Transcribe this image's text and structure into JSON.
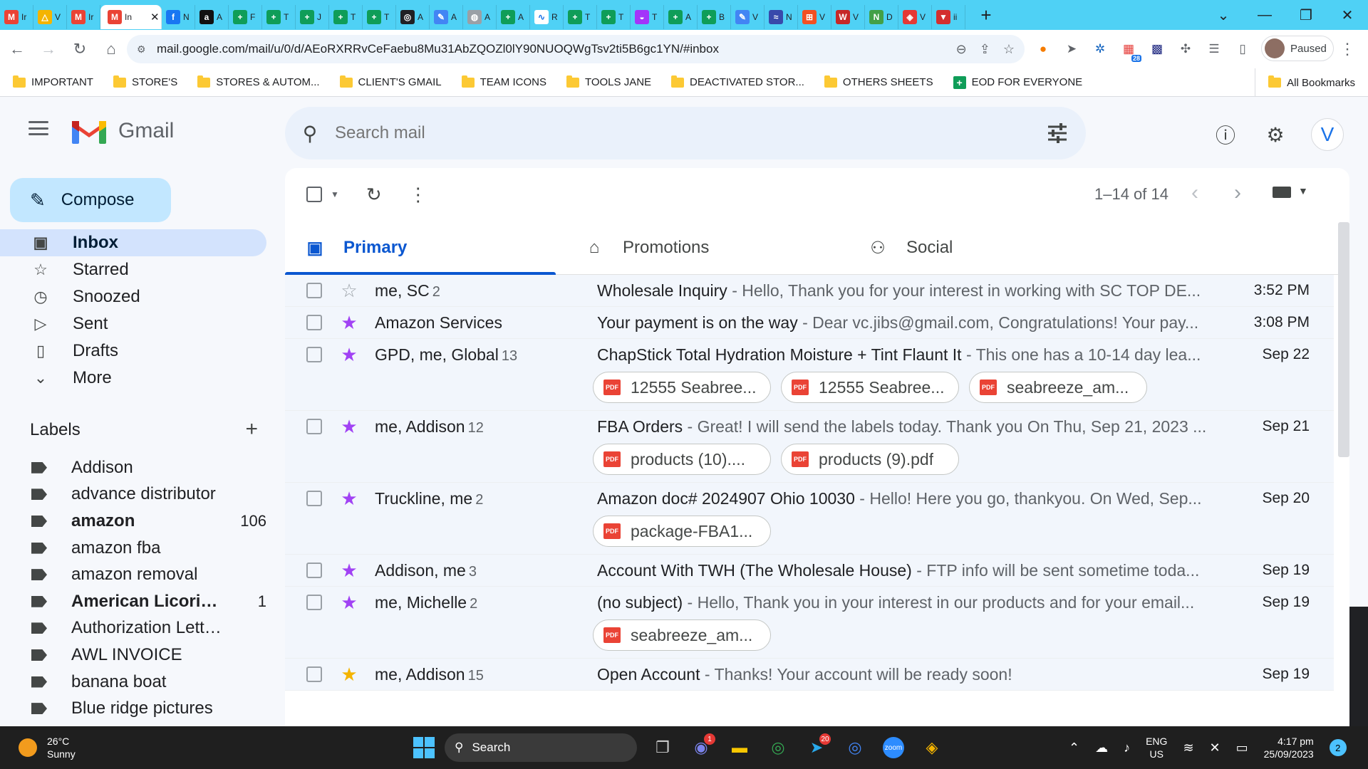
{
  "browser": {
    "tabs": [
      {
        "icon": "gmail-icon",
        "label": "Ir",
        "color": "#ea4335",
        "glyph": "M"
      },
      {
        "icon": "drive-icon",
        "label": "V",
        "color": "#f4b400",
        "glyph": "△"
      },
      {
        "icon": "gmail-icon",
        "label": "Ir",
        "color": "#ea4335",
        "glyph": "M"
      },
      {
        "icon": "gmail-icon",
        "label": "In",
        "color": "#ea4335",
        "glyph": "M",
        "active": true
      },
      {
        "icon": "facebook-icon",
        "label": "N",
        "color": "#1877f2",
        "glyph": "f"
      },
      {
        "icon": "amazon-icon",
        "label": "A",
        "color": "#111111",
        "glyph": "a"
      },
      {
        "icon": "sheets-icon",
        "label": "F",
        "color": "#0f9d58",
        "glyph": "+"
      },
      {
        "icon": "sheets-icon",
        "label": "T",
        "color": "#0f9d58",
        "glyph": "+"
      },
      {
        "icon": "sheets-icon",
        "label": "J",
        "color": "#0f9d58",
        "glyph": "+"
      },
      {
        "icon": "sheets-icon",
        "label": "T",
        "color": "#0f9d58",
        "glyph": "+"
      },
      {
        "icon": "sheets-icon",
        "label": "T",
        "color": "#0f9d58",
        "glyph": "+"
      },
      {
        "icon": "chatgpt-icon",
        "label": "A",
        "color": "#202124",
        "glyph": "◎"
      },
      {
        "icon": "pencil-icon",
        "label": "A",
        "color": "#4285f4",
        "glyph": "✎"
      },
      {
        "icon": "globe-icon",
        "label": "A",
        "color": "#9aa0a6",
        "glyph": "◍"
      },
      {
        "icon": "sheets-icon",
        "label": "A",
        "color": "#0f9d58",
        "glyph": "+"
      },
      {
        "icon": "chart-icon",
        "label": "R",
        "color": "#ffffff",
        "glyph": "∿"
      },
      {
        "icon": "sheets-icon",
        "label": "T",
        "color": "#0f9d58",
        "glyph": "+"
      },
      {
        "icon": "sheets-icon",
        "label": "T",
        "color": "#0f9d58",
        "glyph": "+"
      },
      {
        "icon": "messenger-icon",
        "label": "T",
        "color": "#a334fa",
        "glyph": "◒"
      },
      {
        "icon": "sheets-icon",
        "label": "A",
        "color": "#0f9d58",
        "glyph": "+"
      },
      {
        "icon": "sheets-icon",
        "label": "B",
        "color": "#0f9d58",
        "glyph": "+"
      },
      {
        "icon": "pencil-icon",
        "label": "V",
        "color": "#4285f4",
        "glyph": "✎"
      },
      {
        "icon": "wave-icon",
        "label": "N",
        "color": "#3949ab",
        "glyph": "≈"
      },
      {
        "icon": "microsoft-icon",
        "label": "V",
        "color": "#f25022",
        "glyph": "⊞"
      },
      {
        "icon": "w-icon",
        "label": "V",
        "color": "#c62828",
        "glyph": "W"
      },
      {
        "icon": "n-icon",
        "label": "D",
        "color": "#43a047",
        "glyph": "N"
      },
      {
        "icon": "shop-icon",
        "label": "V",
        "color": "#e53935",
        "glyph": "◈"
      },
      {
        "icon": "shield-icon",
        "label": "ii",
        "color": "#d32f2f",
        "glyph": "▼"
      }
    ],
    "url": "mail.google.com/mail/u/0/d/AEoRXRRvCeFaebu8Mu31AbZQOZl0lY90NUOQWgTsv2ti5B6gc1YN/#inbox",
    "profile_label": "Paused",
    "ext_badge": "28",
    "bookmarks": [
      {
        "label": "IMPORTANT",
        "type": "folder"
      },
      {
        "label": "STORE'S",
        "type": "folder"
      },
      {
        "label": "STORES & AUTOM...",
        "type": "folder"
      },
      {
        "label": "CLIENT'S GMAIL",
        "type": "folder"
      },
      {
        "label": "TEAM ICONS",
        "type": "folder"
      },
      {
        "label": "TOOLS JANE",
        "type": "folder"
      },
      {
        "label": "DEACTIVATED STOR...",
        "type": "folder"
      },
      {
        "label": "OTHERS SHEETS",
        "type": "folder"
      },
      {
        "label": "EOD FOR EVERYONE",
        "type": "sheet"
      }
    ],
    "all_bookmarks": "All Bookmarks"
  },
  "gmail": {
    "logo_text": "Gmail",
    "search_placeholder": "Search mail",
    "avatar_letter": "V",
    "compose_label": "Compose",
    "nav": [
      {
        "label": "Inbox",
        "icon": "inbox-icon",
        "glyph": "▣",
        "active": true
      },
      {
        "label": "Starred",
        "icon": "star-icon",
        "glyph": "☆"
      },
      {
        "label": "Snoozed",
        "icon": "clock-icon",
        "glyph": "◷"
      },
      {
        "label": "Sent",
        "icon": "send-icon",
        "glyph": "▷"
      },
      {
        "label": "Drafts",
        "icon": "draft-icon",
        "glyph": "▯"
      },
      {
        "label": "More",
        "icon": "chevron-down-icon",
        "glyph": "⌄"
      }
    ],
    "labels_title": "Labels",
    "labels": [
      {
        "name": "Addison",
        "count": "",
        "bold": false
      },
      {
        "name": "advance distributor",
        "count": "",
        "bold": false
      },
      {
        "name": "amazon",
        "count": "106",
        "bold": true
      },
      {
        "name": "amazon fba",
        "count": "",
        "bold": false
      },
      {
        "name": "amazon removal",
        "count": "",
        "bold": false
      },
      {
        "name": "American Licorice ...",
        "count": "1",
        "bold": true
      },
      {
        "name": "Authorization Letters",
        "count": "",
        "bold": false
      },
      {
        "name": "AWL INVOICE",
        "count": "",
        "bold": false
      },
      {
        "name": "banana boat",
        "count": "",
        "bold": false
      },
      {
        "name": "Blue ridge pictures",
        "count": "",
        "bold": false
      }
    ],
    "pager": "1–14 of 14",
    "tabs": [
      {
        "id": "primary",
        "label": "Primary",
        "glyph": "▣"
      },
      {
        "id": "promotions",
        "label": "Promotions",
        "glyph": "⌂"
      },
      {
        "id": "social",
        "label": "Social",
        "glyph": "⚇"
      }
    ],
    "emails": [
      {
        "sender": "me, SC",
        "count": "2",
        "subject": "Wholesale Inquiry",
        "snippet": " - Hello, Thank you for your interest in working with SC TOP DE...",
        "date": "3:52 PM",
        "star": "empty",
        "attachments": []
      },
      {
        "sender": "Amazon Services",
        "count": "",
        "subject": "Your payment is on the way",
        "snippet": " - Dear vc.jibs@gmail.com, Congratulations! Your pay...",
        "date": "3:08 PM",
        "star": "purple",
        "attachments": []
      },
      {
        "sender": "GPD, me, Global",
        "count": "13",
        "subject": "ChapStick Total Hydration Moisture + Tint Flaunt It",
        "snippet": " - This one has a 10-14 day lea...",
        "date": "Sep 22",
        "star": "purple",
        "attachments": [
          "12555 Seabree...",
          "12555 Seabree...",
          "seabreeze_am..."
        ]
      },
      {
        "sender": "me, Addison",
        "count": "12",
        "subject": "FBA Orders",
        "snippet": " - Great! I will send the labels today. Thank you On Thu, Sep 21, 2023 ...",
        "date": "Sep 21",
        "star": "purple",
        "attachments": [
          "products (10)....",
          "products (9).pdf"
        ]
      },
      {
        "sender": "Truckline, me",
        "count": "2",
        "subject": "Amazon doc# 2024907 Ohio 10030",
        "snippet": " - Hello! Here you go, thankyou. On Wed, Sep...",
        "date": "Sep 20",
        "star": "purple",
        "attachments": [
          "package-FBA1..."
        ]
      },
      {
        "sender": "Addison, me",
        "count": "3",
        "subject": "Account With TWH (The Wholesale House)",
        "snippet": " - FTP info will be sent sometime toda...",
        "date": "Sep 19",
        "star": "purple",
        "attachments": []
      },
      {
        "sender": "me, Michelle",
        "count": "2",
        "subject": "(no subject)",
        "snippet": " - Hello, Thank you in your interest in our products and for your email...",
        "date": "Sep 19",
        "star": "purple",
        "attachments": [
          "seabreeze_am..."
        ]
      },
      {
        "sender": "me, Addison",
        "count": "15",
        "subject": "Open Account",
        "snippet": " - Thanks! Your account will be ready soon!",
        "date": "Sep 19",
        "star": "yellow",
        "attachments": []
      }
    ],
    "colors": {
      "star_purple": "#a142f4",
      "star_yellow": "#f4b400",
      "star_empty": "#9aa0a6",
      "accent": "#0b57d0"
    },
    "pdf_label": "PDF"
  },
  "taskbar": {
    "temp": "26°C",
    "weather": "Sunny",
    "search_label": "Search",
    "apps": [
      {
        "icon": "task-view-icon",
        "glyph": "❐",
        "color": "#d0d0d0",
        "badge": ""
      },
      {
        "icon": "teams-icon",
        "glyph": "◉",
        "color": "#7b83eb",
        "badge": "1"
      },
      {
        "icon": "file-explorer-icon",
        "glyph": "▬",
        "color": "#f9c700",
        "badge": ""
      },
      {
        "icon": "chrome-icon",
        "glyph": "◎",
        "color": "#34a853",
        "badge": ""
      },
      {
        "icon": "telegram-icon",
        "glyph": "➤",
        "color": "#29a9eb",
        "badge": "20"
      },
      {
        "icon": "chrome-profile-icon",
        "glyph": "◎",
        "color": "#4285f4",
        "badge": ""
      },
      {
        "icon": "zoom-icon",
        "glyph": "zoom",
        "color": "#2d8cff",
        "badge": ""
      },
      {
        "icon": "vpn-icon",
        "glyph": "◈",
        "color": "#f4b400",
        "badge": ""
      }
    ],
    "lang": "ENG",
    "region": "US",
    "time": "4:17 pm",
    "date": "25/09/2023",
    "notifications": "2"
  }
}
